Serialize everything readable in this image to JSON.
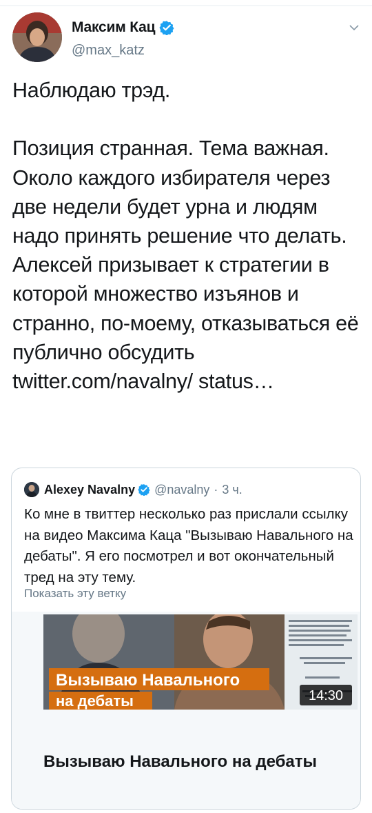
{
  "author": {
    "name": "Максим Кац",
    "handle": "@max_katz"
  },
  "tweet": {
    "text": "Наблюдаю трэд.\n\nПозиция странная. Тема важная. Около каждого избирателя через две недели будет урна и людям надо принять решение что делать. Алексей призывает к стратегии в которой множество изъянов и странно, по-моему, отказываться её публично обсудить twitter.com/navalny/ status…"
  },
  "quoted": {
    "name": "Alexey Navalny",
    "handle": "@navalny",
    "separator": "·",
    "time": "3 ч.",
    "text": "Ко мне в твиттер несколько раз прислали ссылку на видео Максима Каца \"Вызываю Навального на дебаты\". Я его посмотрел и вот окончательный тред на эту тему.",
    "show_thread": "Показать эту ветку"
  },
  "video": {
    "overlay_line1": "Вызываю Навального",
    "overlay_line2": "на дебаты",
    "duration": "14:30",
    "title": "Вызываю Навального на дебаты"
  },
  "colors": {
    "verified": "#1da1f2",
    "overlay": "#d56e10",
    "handle": "#657786"
  }
}
